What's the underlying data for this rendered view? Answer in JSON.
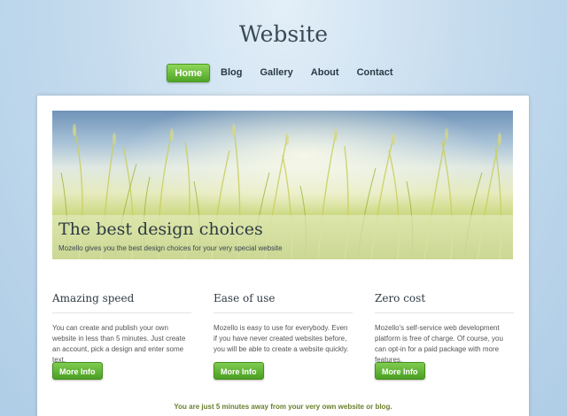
{
  "site": {
    "title": "Website"
  },
  "nav": {
    "items": [
      {
        "label": "Home",
        "active": true
      },
      {
        "label": "Blog",
        "active": false
      },
      {
        "label": "Gallery",
        "active": false
      },
      {
        "label": "About",
        "active": false
      },
      {
        "label": "Contact",
        "active": false
      }
    ]
  },
  "hero": {
    "title": "The best design choices",
    "subtitle": "Mozello gives you the best design choices for your very special website"
  },
  "features": [
    {
      "title": "Amazing speed",
      "text": "You can create and publish your own website in less than 5 minutes. Just create an account, pick a design and enter some text.",
      "button": "More Info"
    },
    {
      "title": "Ease of use",
      "text": "Mozello is easy to use for everybody. Even if you have never created websites before, you will be able to create a website quickly.",
      "button": "More Info"
    },
    {
      "title": "Zero cost",
      "text": "Mozello's self-service web development platform is free of charge. Of course, you can opt-in for a paid package with more features.",
      "button": "More Info"
    }
  ],
  "footer": {
    "text": "You are just 5 minutes away from your very own website or blog."
  },
  "colors": {
    "accent": "#5cb42e",
    "background": "#c6dcee"
  }
}
